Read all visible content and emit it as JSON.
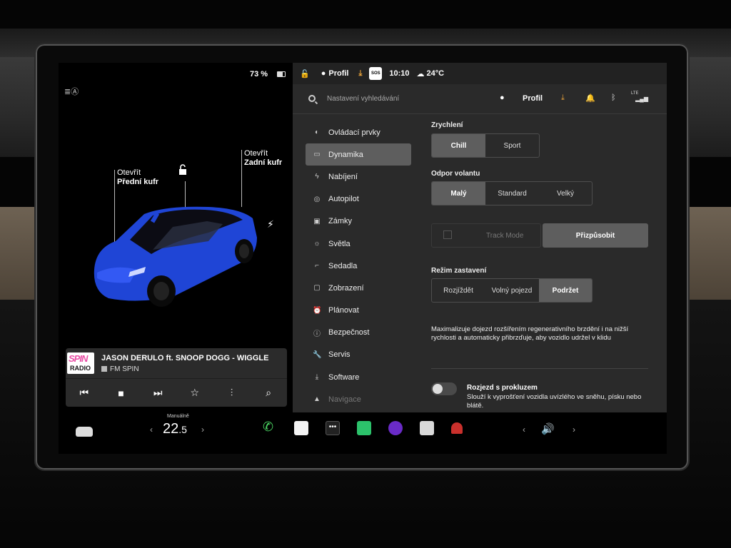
{
  "left_panel": {
    "battery_percent": "73 %",
    "front_trunk": {
      "action": "Otevřít",
      "label": "Přední kufr"
    },
    "rear_trunk": {
      "action": "Otevřít",
      "label": "Zadní kufr"
    },
    "car_color": "#1f45d6"
  },
  "media": {
    "song": "JASON DERULO ft. SNOOP DOGG - WIGGLE",
    "station": "FM SPIN",
    "logo_top": "SPIN",
    "logo_bottom": "RADIO"
  },
  "status_bar": {
    "profile": "Profil",
    "time": "10:10",
    "temperature": "24°C",
    "sos": "SOS"
  },
  "settings": {
    "search_placeholder": "Nastavení vyhledávání",
    "profile": "Profil",
    "network": "LTE",
    "nav": [
      {
        "label": "Ovládací prvky",
        "icon": "toggle-icon"
      },
      {
        "label": "Dynamika",
        "icon": "car-icon",
        "active": true
      },
      {
        "label": "Nabíjení",
        "icon": "bolt-icon"
      },
      {
        "label": "Autopilot",
        "icon": "steering-wheel-icon"
      },
      {
        "label": "Zámky",
        "icon": "lock-icon"
      },
      {
        "label": "Světla",
        "icon": "sun-icon"
      },
      {
        "label": "Sedadla",
        "icon": "seat-icon"
      },
      {
        "label": "Zobrazení",
        "icon": "display-icon"
      },
      {
        "label": "Plánovat",
        "icon": "alarm-clock-icon"
      },
      {
        "label": "Bezpečnost",
        "icon": "info-icon"
      },
      {
        "label": "Servis",
        "icon": "wrench-icon"
      },
      {
        "label": "Software",
        "icon": "download-icon"
      },
      {
        "label": "Navigace",
        "icon": "navigation-icon"
      }
    ],
    "acceleration": {
      "title": "Zrychlení",
      "options": [
        "Chill",
        "Sport"
      ],
      "selected": "Chill"
    },
    "steering": {
      "title": "Odpor volantu",
      "options": [
        "Malý",
        "Standard",
        "Velký"
      ],
      "selected": "Malý"
    },
    "track_mode": {
      "label": "Track Mode",
      "customize": "Přizpůsobit"
    },
    "stopping": {
      "title": "Režim zastavení",
      "options": [
        "Rozjíždět",
        "Volný pojezd",
        "Podržet"
      ],
      "selected": "Podržet",
      "description": "Maximalizuje dojezd rozšířením regenerativního brzdění i na nižší rychlosti a automaticky přibrzďuje, aby vozidlo udržel v klidu"
    },
    "slip_start": {
      "title": "Rozjezd s prokluzem",
      "description": "Slouží k vyprošťení vozidla uvízlého ve sněhu, písku nebo blátě.",
      "enabled": false
    }
  },
  "taskbar": {
    "temp_mode": "Manuálně",
    "temp_whole": "22",
    "temp_decimal": ".5",
    "apps": [
      "phone-icon",
      "notes-icon",
      "more-icon",
      "stocks-icon",
      "camera-icon",
      "calendar-icon",
      "joystick-icon"
    ]
  }
}
